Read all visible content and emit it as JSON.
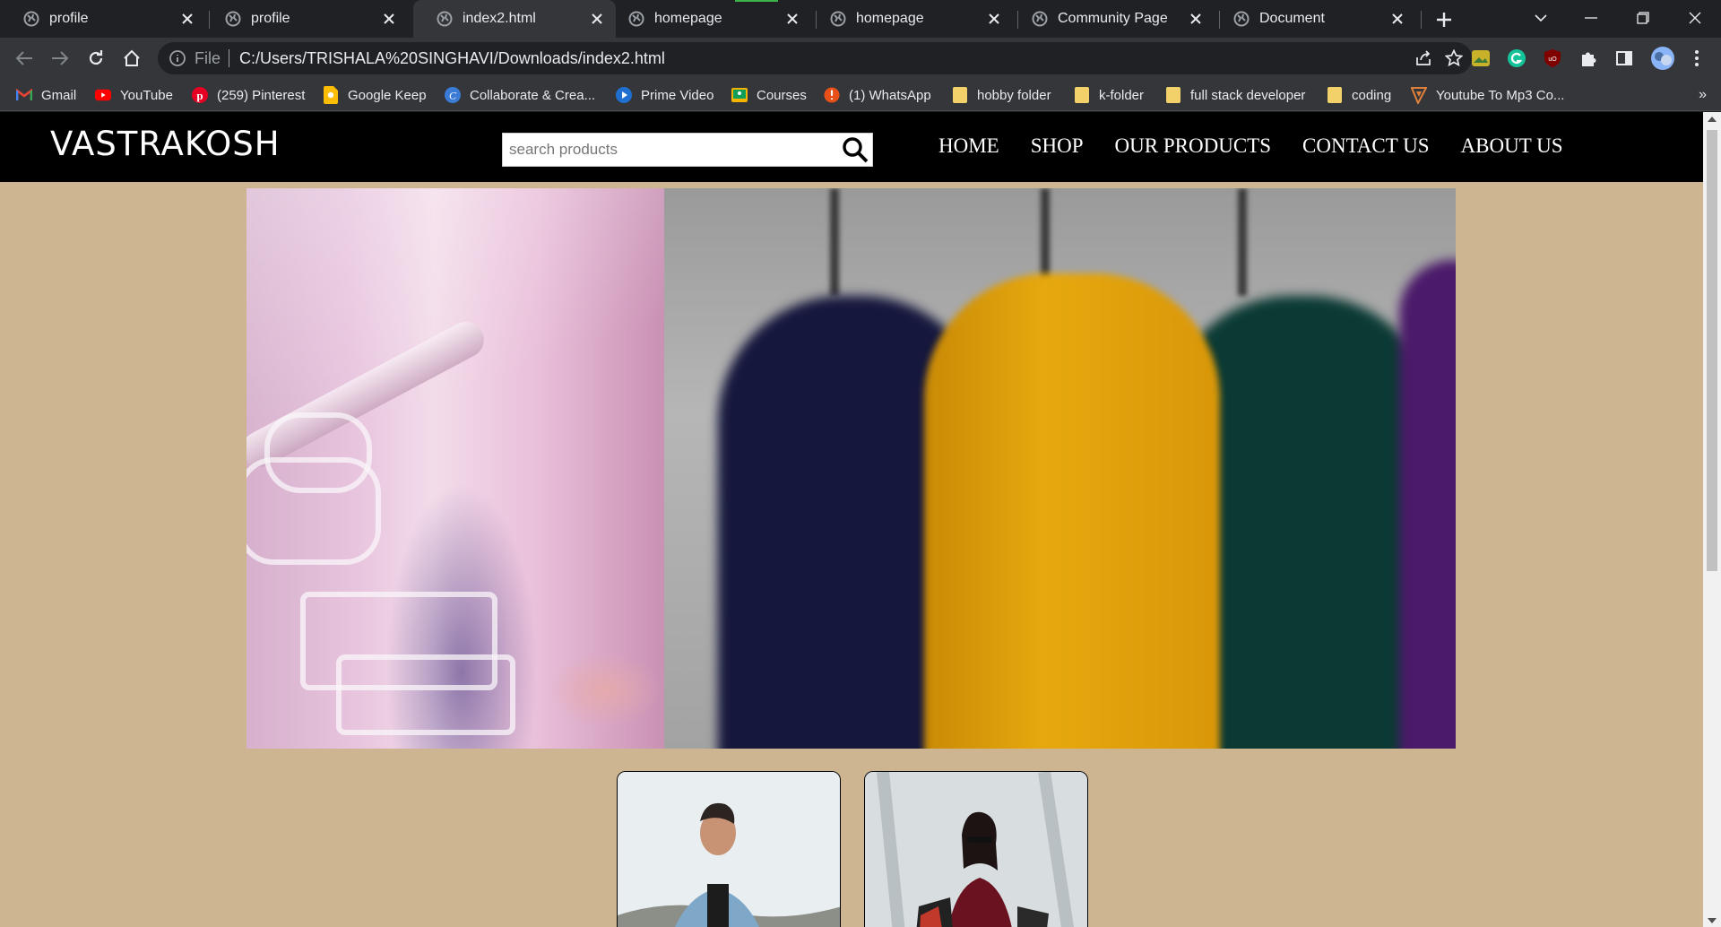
{
  "tabs": [
    {
      "title": "profile"
    },
    {
      "title": "profile"
    },
    {
      "title": "index2.html",
      "active": true
    },
    {
      "title": "homepage"
    },
    {
      "title": "homepage"
    },
    {
      "title": "Community Page"
    },
    {
      "title": "Document"
    }
  ],
  "toolbar": {
    "scheme_label": "File",
    "url": "C:/Users/TRISHALA%20SINGHAVI/Downloads/index2.html"
  },
  "bookmarks": [
    {
      "label": "Gmail",
      "icon": "gmail-icon"
    },
    {
      "label": "YouTube",
      "icon": "youtube-icon"
    },
    {
      "label": "(259) Pinterest",
      "icon": "pinterest-icon"
    },
    {
      "label": "Google Keep",
      "icon": "google-keep-icon"
    },
    {
      "label": "Collaborate & Crea...",
      "icon": "canva-icon"
    },
    {
      "label": "Prime Video",
      "icon": "prime-video-icon"
    },
    {
      "label": "Courses",
      "icon": "classroom-icon"
    },
    {
      "label": "(1) WhatsApp",
      "icon": "whatsapp-icon"
    },
    {
      "label": "hobby folder",
      "icon": "folder-icon"
    },
    {
      "label": "k-folder",
      "icon": "folder-icon"
    },
    {
      "label": "full stack developer",
      "icon": "folder-icon"
    },
    {
      "label": "coding",
      "icon": "folder-icon"
    },
    {
      "label": "Youtube To Mp3 Co...",
      "icon": "mp3-converter-icon"
    }
  ],
  "bookmarks_overflow": "»",
  "site": {
    "logo": "VASTRAKOSH",
    "search_placeholder": "search products",
    "nav": [
      "HOME",
      "SHOP",
      "OUR PRODUCTS",
      "CONTACT US",
      "ABOUT US"
    ]
  },
  "colors": {
    "page_background": "#cdb591",
    "site_nav_background": "#000000",
    "browser_frame": "#202124",
    "toolbar": "#35363a"
  }
}
